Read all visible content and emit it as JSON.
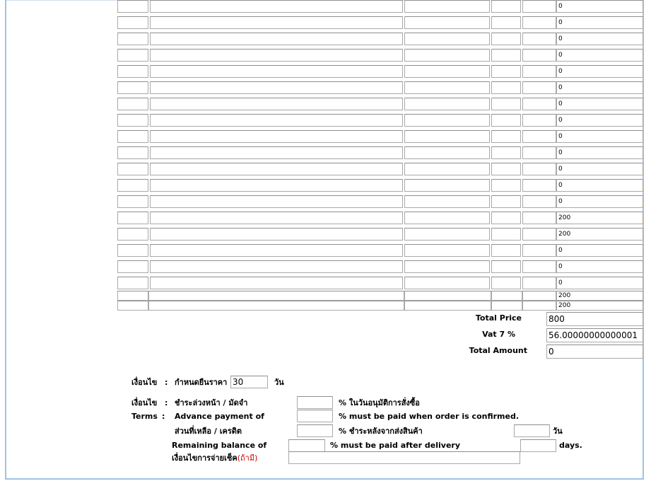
{
  "items": {
    "rows": [
      {
        "total": "0"
      },
      {
        "total": "0"
      },
      {
        "total": "0"
      },
      {
        "total": "0"
      },
      {
        "total": "0"
      },
      {
        "total": "0"
      },
      {
        "total": "0"
      },
      {
        "total": "0"
      },
      {
        "total": "0"
      },
      {
        "total": "0"
      },
      {
        "total": "0"
      },
      {
        "total": "0"
      },
      {
        "total": "0"
      },
      {
        "total": "200"
      },
      {
        "total": "200"
      },
      {
        "total": "0"
      },
      {
        "total": "0"
      },
      {
        "total": "0"
      }
    ],
    "extra_rows": [
      {
        "total": "200"
      },
      {
        "total": "200"
      }
    ]
  },
  "summary": {
    "total_price_label": "Total Price",
    "total_price_value": "800",
    "vat_label": "Vat 7 %",
    "vat_value": "56.00000000000001",
    "total_amount_label": "Total Amount",
    "total_amount_value": "0"
  },
  "terms": {
    "price_validity_label_th": "เงื่อนไข",
    "colon": ":",
    "price_validity_text_th": "กำหนดยืนราคา",
    "price_validity_value": "30",
    "days_th": "วัน",
    "payment_label_th": "เงื่อนไข",
    "advance_th": "ชำระล่วงหน้า / มัดจำ",
    "advance_pct_th": "% ในวันอนุมัติการสั่งซื้อ",
    "terms_label_en": "Terms",
    "advance_en": "Advance payment of",
    "advance_pct_en": "% must be paid when order is confirmed.",
    "balance_th": "ส่วนที่เหลือ / เครดิต",
    "balance_pct_th": "% ชำระหลังจากส่งสินค้า",
    "balance_days_th": "วัน",
    "balance_en": "Remaining balance of",
    "balance_pct_en": "%  must be paid after delivery",
    "balance_days_en": "days.",
    "cheque_label_th": "เงื่อนไขการจ่ายเช็ค",
    "cheque_optional_th": "(ถ้ามี)"
  }
}
